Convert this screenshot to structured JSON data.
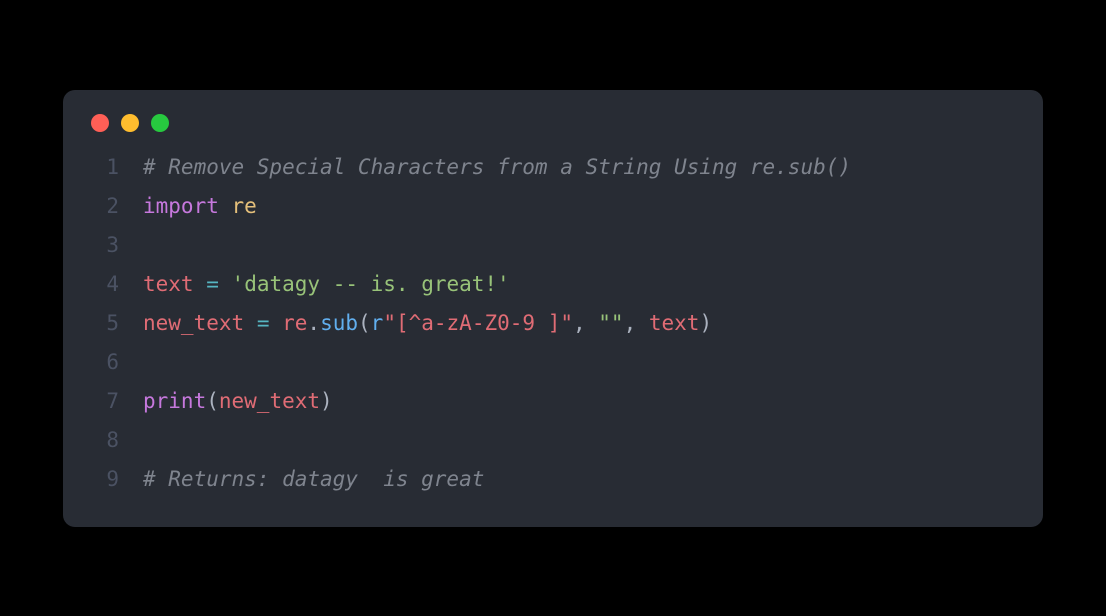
{
  "lines": {
    "n1": "1",
    "n2": "2",
    "n3": "3",
    "n4": "4",
    "n5": "5",
    "n6": "6",
    "n7": "7",
    "n8": "8",
    "n9": "9"
  },
  "code": {
    "l1_comment": "# Remove Special Characters from a String Using re.sub()",
    "l2_import": "import",
    "l2_space": " ",
    "l2_re": "re",
    "l4_text": "text",
    "l4_sp1": " ",
    "l4_eq": "=",
    "l4_sp2": " ",
    "l4_str": "'datagy -- is. great!'",
    "l5_newtext": "new_text",
    "l5_sp1": " ",
    "l5_eq": "=",
    "l5_sp2": " ",
    "l5_re": "re",
    "l5_dot": ".",
    "l5_sub": "sub",
    "l5_paren1": "(",
    "l5_r": "r",
    "l5_regex": "\"[^a-zA-Z0-9 ]\"",
    "l5_comma1": ", ",
    "l5_empty": "\"\"",
    "l5_comma2": ", ",
    "l5_textarg": "text",
    "l5_paren2": ")",
    "l7_print": "print",
    "l7_paren1": "(",
    "l7_newtext": "new_text",
    "l7_paren2": ")",
    "l9_comment": "# Returns: datagy  is great"
  }
}
